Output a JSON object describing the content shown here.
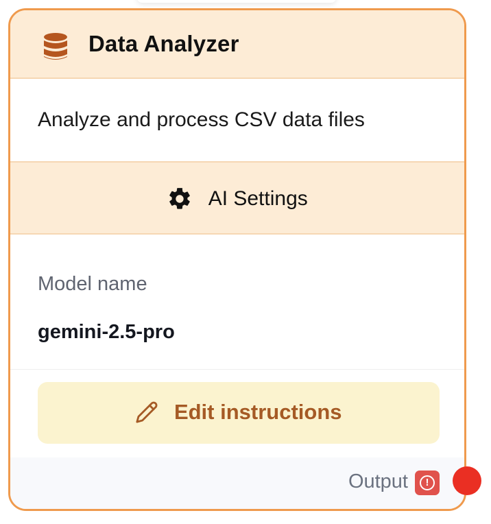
{
  "node": {
    "title": "Data Analyzer",
    "header_icon": "database-icon",
    "description": "Analyze and process CSV data files",
    "border_color": "#ef9a4d",
    "header_color": "#fdecd6"
  },
  "settings": {
    "icon": "gear-icon",
    "label": "AI Settings"
  },
  "model": {
    "label": "Model name",
    "value": "gemini-2.5-pro"
  },
  "edit_button": {
    "icon": "pencil-icon",
    "label": "Edit instructions",
    "background": "#fbf3cf",
    "text_color": "#a55a25"
  },
  "output": {
    "label": "Output",
    "status_icon": "alert-icon",
    "status_color": "#e0524c",
    "handle_color": "#ea2f23"
  }
}
